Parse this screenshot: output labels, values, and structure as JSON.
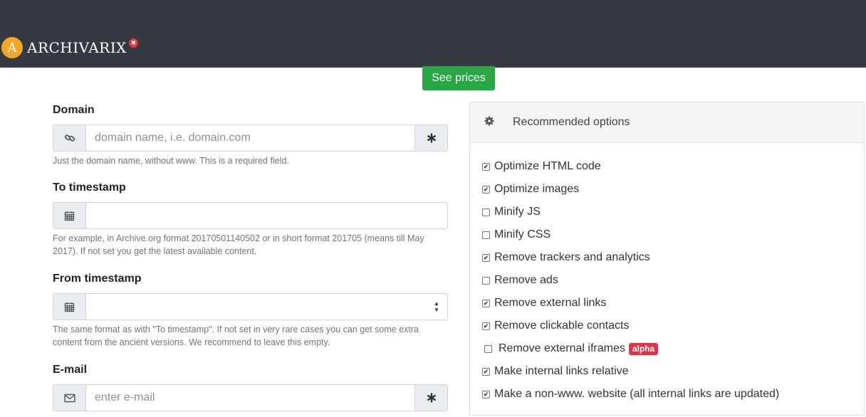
{
  "header": {
    "logo_letter": "A",
    "brand": "ARCHIVARIX",
    "flag_glyph": "✖",
    "see_prices": "See prices"
  },
  "form": {
    "domain": {
      "label": "Domain",
      "placeholder": "domain name, i.e. domain.com",
      "value": "",
      "help": "Just the domain name, without www. This is a required field."
    },
    "to_timestamp": {
      "label": "To timestamp",
      "value": "",
      "help": "For example, in Archive.org format 20170501140502 or in short format 201705 (means till May 2017). If not set you get the latest available content."
    },
    "from_timestamp": {
      "label": "From timestamp",
      "value": "",
      "help": "The same format as with \"To timestamp\". If not set in very rare cases you can get some extra content from the ancient versions. We recommend to leave this empty."
    },
    "email": {
      "label": "E-mail",
      "placeholder": "enter e-mail",
      "value": ""
    }
  },
  "icons": {
    "domain": "link-icon",
    "calendar": "calendar-icon",
    "email": "envelope-icon",
    "required": "asterisk-icon",
    "settings": "gear-icon"
  },
  "options": {
    "title": "Recommended options",
    "items": [
      {
        "label": "Optimize HTML code",
        "checked": true
      },
      {
        "label": "Optimize images",
        "checked": true
      },
      {
        "label": "Minify JS",
        "checked": false
      },
      {
        "label": "Minify CSS",
        "checked": false
      },
      {
        "label": "Remove trackers and analytics",
        "checked": true
      },
      {
        "label": "Remove ads",
        "checked": false
      },
      {
        "label": "Remove external links",
        "checked": true
      },
      {
        "label": "Remove clickable contacts",
        "checked": true
      },
      {
        "label": "Remove external iframes",
        "checked": false,
        "badge": "alpha"
      },
      {
        "label": "Make internal links relative",
        "checked": true
      },
      {
        "label": "Make a non-www. website (all internal links are updated)",
        "checked": true
      }
    ]
  },
  "colors": {
    "topbar": "#353a42",
    "accent_green": "#28a745",
    "badge_red": "#dc3545",
    "logo_orange": "#f5a623"
  }
}
